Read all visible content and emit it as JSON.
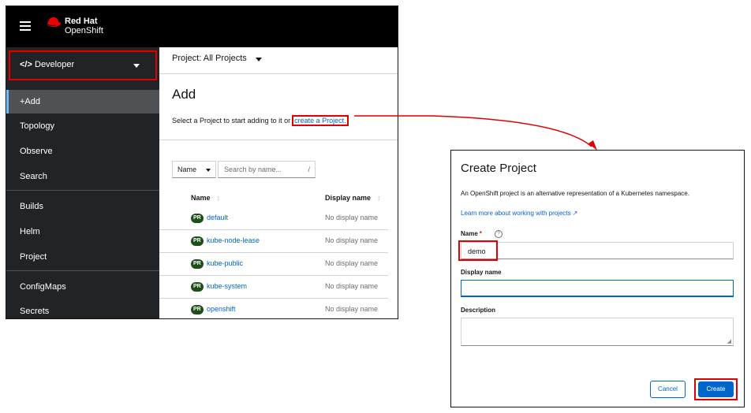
{
  "masthead": {
    "brand_line1": "Red Hat",
    "brand_line2": "OpenShift",
    "brand_color": "#ee0000"
  },
  "sidebar": {
    "perspective": {
      "icon": "code-icon",
      "icon_glyph": "</>",
      "label": "Developer"
    },
    "items": [
      {
        "label": "+Add",
        "active": true
      },
      {
        "label": "Topology"
      },
      {
        "label": "Observe"
      },
      {
        "label": "Search"
      },
      {
        "label": "Builds"
      },
      {
        "label": "Helm"
      },
      {
        "label": "Project"
      },
      {
        "label": "ConfigMaps"
      },
      {
        "label": "Secrets"
      }
    ]
  },
  "main": {
    "project_selector": "Project: All Projects",
    "title": "Add",
    "description": "Select a Project to start adding to it or",
    "create_link": "create a Project.",
    "filter": {
      "selected": "Name",
      "placeholder": "Search by name...",
      "shortcut": "/"
    },
    "table": {
      "columns": [
        "Name",
        "Display name"
      ],
      "badge": "PR",
      "rows": [
        {
          "name": "default",
          "display": "No display name"
        },
        {
          "name": "kube-node-lease",
          "display": "No display name"
        },
        {
          "name": "kube-public",
          "display": "No display name"
        },
        {
          "name": "kube-system",
          "display": "No display name"
        },
        {
          "name": "openshift",
          "display": "No display name"
        }
      ]
    }
  },
  "modal": {
    "title": "Create Project",
    "description": "An OpenShift project is an alternative representation of a Kubernetes namespace.",
    "learn_more": "Learn more about working with projects",
    "name_label": "Name",
    "required_mark": "*",
    "name_value": "demo",
    "display_name_label": "Display name",
    "display_name_value": "",
    "description_label": "Description",
    "description_value": "",
    "cancel_label": "Cancel",
    "create_label": "Create"
  },
  "colors": {
    "highlight": "#e00000",
    "link": "#0066cc",
    "sidebar_bg": "#212427",
    "badge_bg": "#1e4f18"
  }
}
